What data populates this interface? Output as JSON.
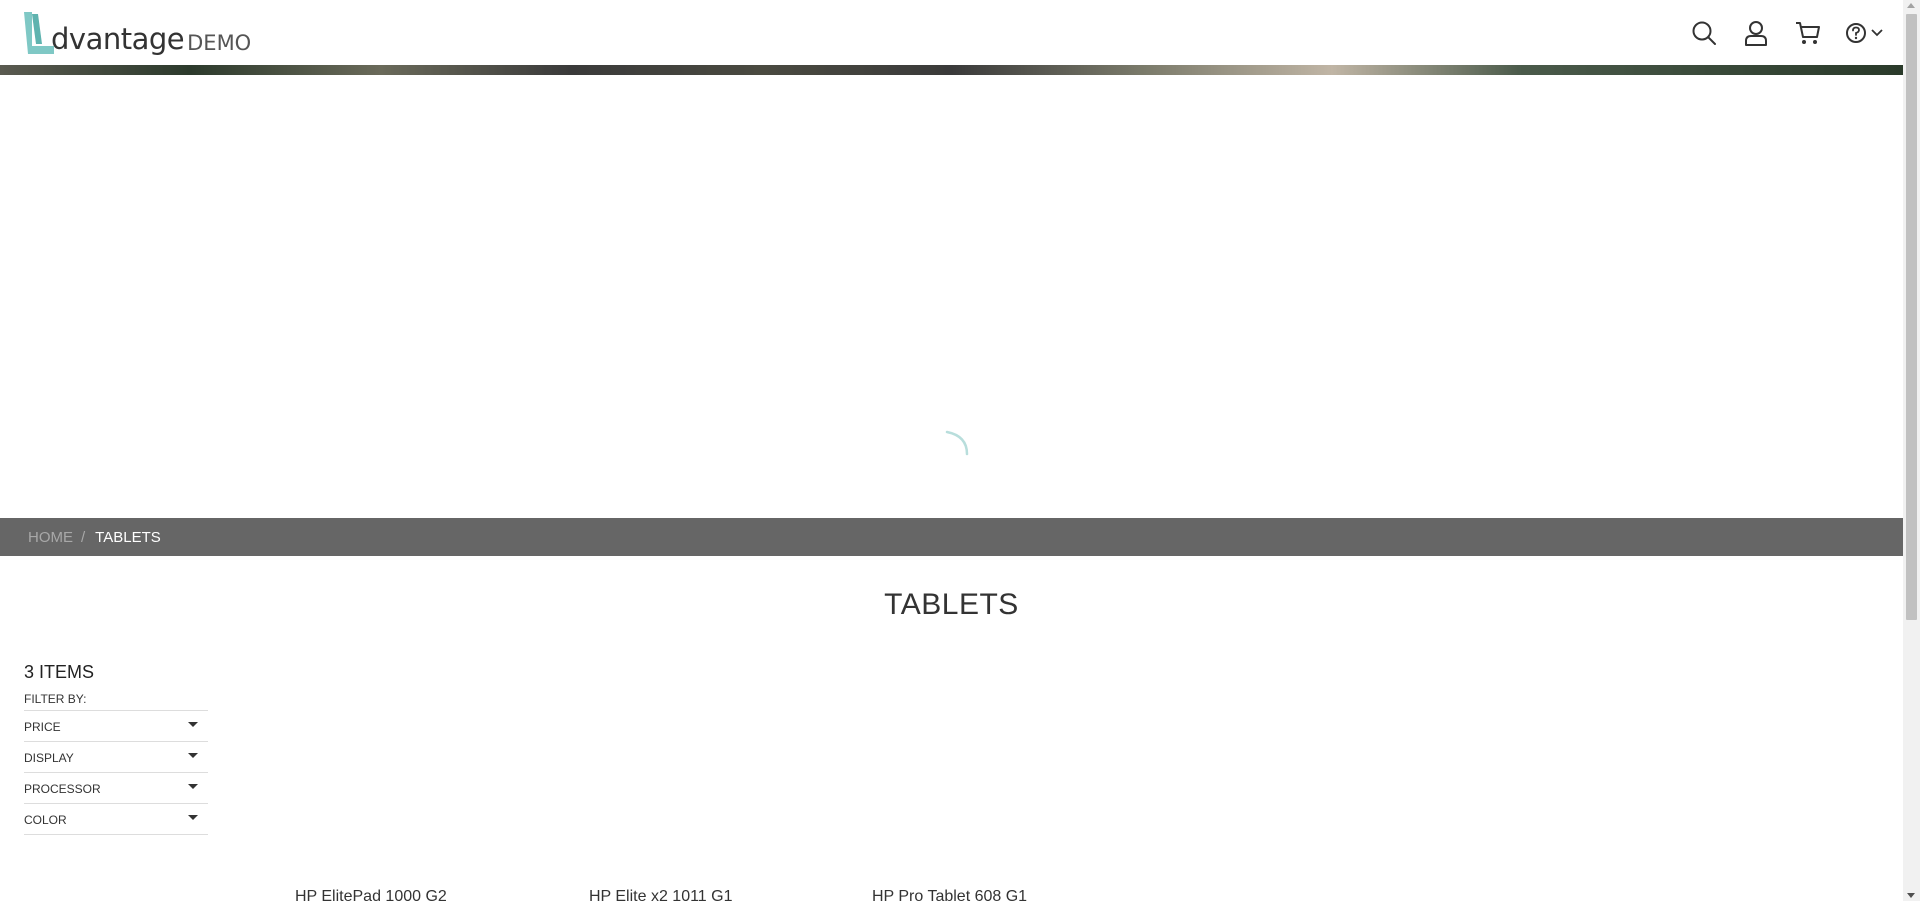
{
  "header": {
    "logo_word": "dvantage",
    "logo_demo": "DEMO",
    "icons": [
      "search-icon",
      "user-icon",
      "cart-icon",
      "help-icon",
      "chevron-down-icon"
    ]
  },
  "breadcrumb": {
    "home": "HOME",
    "separator": "/",
    "current": "TABLETS"
  },
  "page": {
    "title": "TABLETS"
  },
  "sidebar": {
    "items_count": "3 ITEMS",
    "filter_by": "FILTER BY:",
    "filters": [
      "PRICE",
      "DISPLAY",
      "PROCESSOR",
      "COLOR"
    ]
  },
  "products": [
    "HP ElitePad 1000 G2",
    "HP Elite x2 1011 G1",
    "HP Pro Tablet 608 G1"
  ],
  "colors": {
    "brand_accent": "#7fc8c5",
    "breadcrumb_bg": "#666666"
  }
}
